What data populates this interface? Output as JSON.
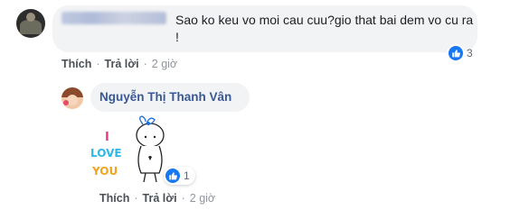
{
  "comment1": {
    "author_blurred": true,
    "text": "Sao ko keu vo moi cau cuu?gio that bai dem vo cu ra !",
    "actions": {
      "like": "Thích",
      "reply": "Trả lời",
      "time": "2 giờ"
    },
    "reactions": {
      "type": "like",
      "count": "3"
    }
  },
  "reply1": {
    "author": "Nguyễn Thị Thanh Vân",
    "sticker": {
      "line1": "I",
      "line2": "LOVE",
      "line3": "YOU"
    },
    "actions": {
      "like": "Thích",
      "reply": "Trả lời",
      "time": "2 giờ"
    },
    "reactions": {
      "type": "like",
      "count": "1"
    }
  },
  "colors": {
    "bubble": "#f2f3f5",
    "author_link": "#385898",
    "like_blue": "#1877f2",
    "meta_gray": "#90949c"
  },
  "icons": [
    "avatar",
    "like-icon",
    "sticker"
  ]
}
